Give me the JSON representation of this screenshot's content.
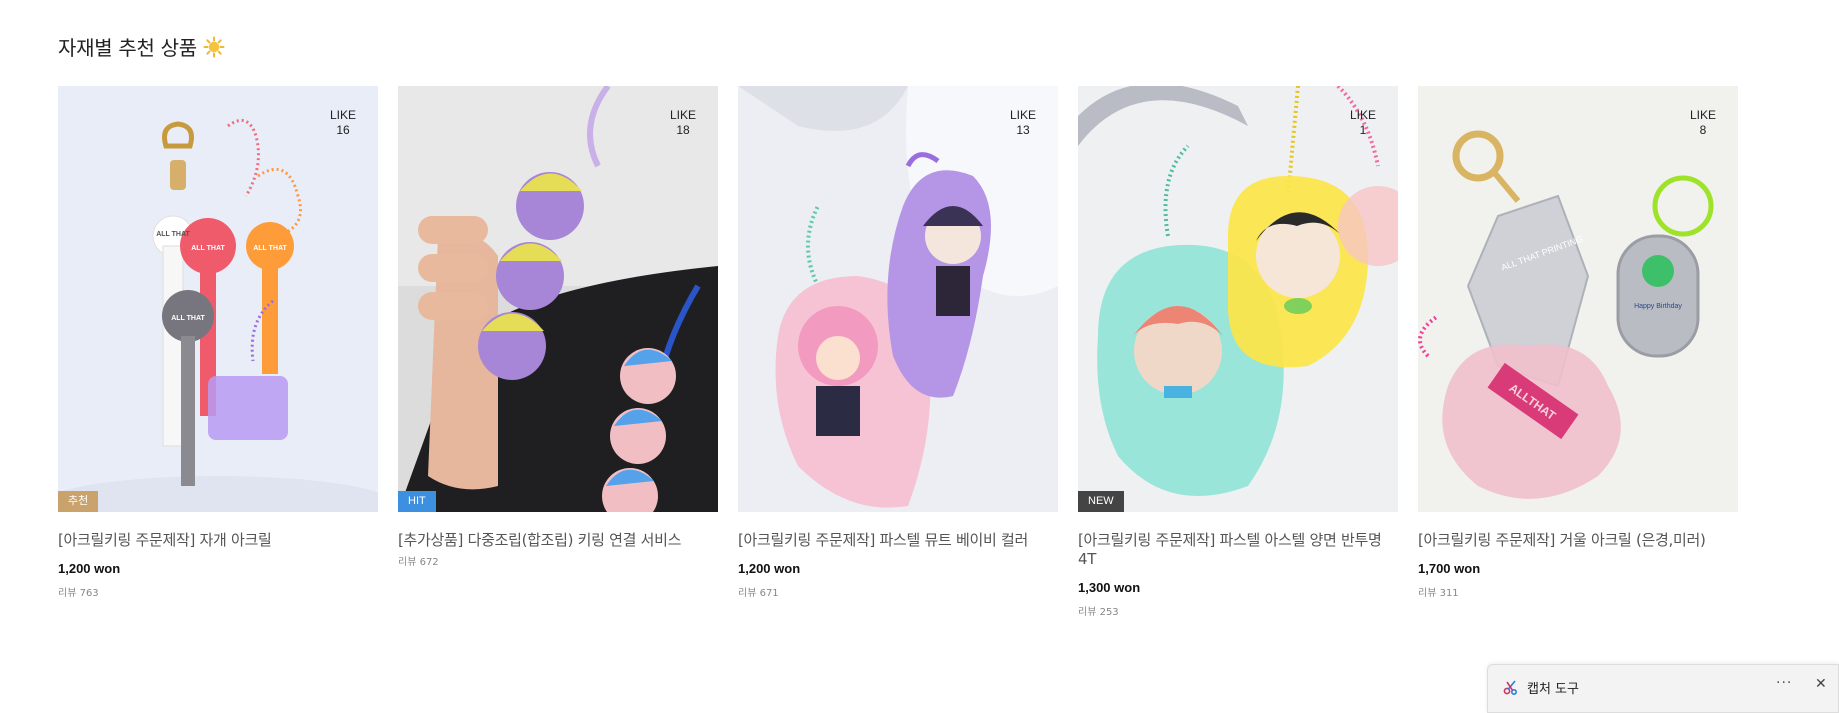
{
  "section": {
    "title": "자재별 추천 상품"
  },
  "products": [
    {
      "name": "[아크릴키링 주문제작] 자개 아크릴",
      "price": "1,200 won",
      "review": "리뷰 763",
      "like_label": "LIKE",
      "like_count": "16",
      "badge": "추천"
    },
    {
      "name": "[추가상품] 다중조립(합조립) 키링 연결 서비스",
      "price": "",
      "review": "리뷰 672",
      "like_label": "LIKE",
      "like_count": "18",
      "badge": "HIT"
    },
    {
      "name": "[아크릴키링 주문제작] 파스텔 뮤트 베이비 컬러",
      "price": "1,200 won",
      "review": "리뷰 671",
      "like_label": "LIKE",
      "like_count": "13",
      "badge": ""
    },
    {
      "name": "[아크릴키링 주문제작] 파스텔 아스텔 양면 반투명 4T",
      "price": "1,300 won",
      "review": "리뷰 253",
      "like_label": "LIKE",
      "like_count": "1",
      "badge": "NEW"
    },
    {
      "name": "[아크릴키링 주문제작] 거울 아크릴 (은경,미러)",
      "price": "1,700 won",
      "review": "리뷰 311",
      "like_label": "LIKE",
      "like_count": "8",
      "badge": ""
    }
  ],
  "snipping_tool": {
    "label": "캡처 도구",
    "more": "···",
    "close": "✕"
  },
  "artwork_text": {
    "keychain_brand": "ALL THAT PRINTING",
    "mirror_tag": "ALLTHAT",
    "birthday": "Happy Birthday"
  }
}
